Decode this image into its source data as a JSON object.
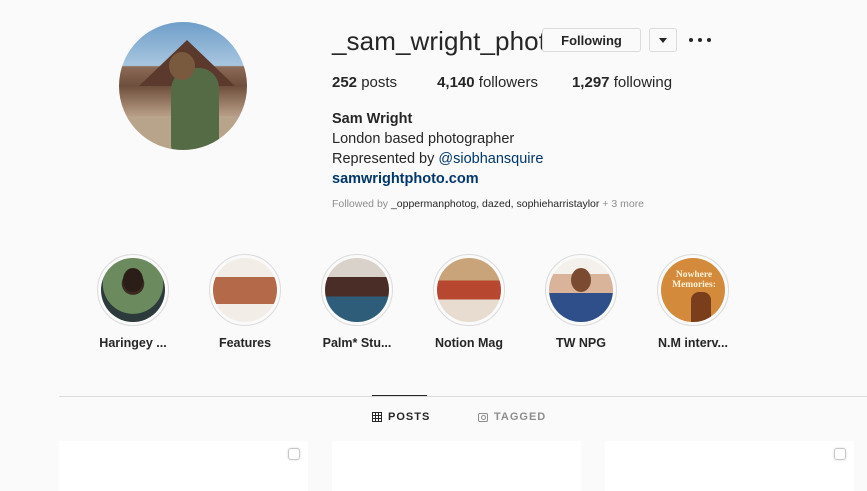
{
  "profile": {
    "username": "_sam_wright_photo",
    "following_button": "Following",
    "stats": {
      "posts_count": "252",
      "posts_label": "posts",
      "followers_count": "4,140",
      "followers_label": "followers",
      "following_count": "1,297",
      "following_label": "following"
    },
    "bio": {
      "name": "Sam Wright",
      "line1": "London based photographer",
      "represented_prefix": "Represented by",
      "represented_handle": "@siobhansquire",
      "website": "samwrightphoto.com"
    },
    "followed_by": {
      "prefix": "Followed by",
      "accounts": [
        "_oppermanphotog",
        "dazed",
        "sophieharristaylor"
      ],
      "more": "+ 3 more"
    }
  },
  "highlights": [
    {
      "label": "Haringey ..."
    },
    {
      "label": "Features"
    },
    {
      "label": "Palm* Stu..."
    },
    {
      "label": "Notion Mag"
    },
    {
      "label": "TW NPG"
    },
    {
      "label": "N.M interv..."
    }
  ],
  "highlight_6_text": "Nowhere Memories:",
  "tabs": {
    "posts": "POSTS",
    "tagged": "TAGGED"
  },
  "colors": {
    "link": "#00376b",
    "text": "#262626",
    "muted": "#8e8e8e",
    "border": "#dbdbdb",
    "background": "#fafafa"
  },
  "icons": [
    "more-options-icon",
    "dropdown-arrow-icon",
    "grid-icon",
    "tag-icon",
    "multiple-posts-icon"
  ]
}
